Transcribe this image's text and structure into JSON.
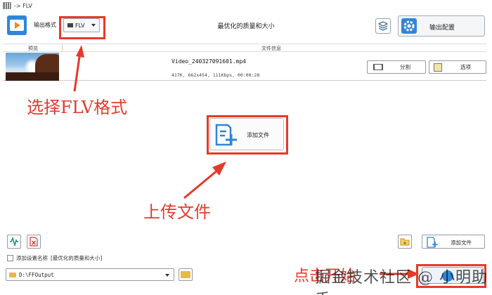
{
  "window": {
    "title": "-> FLV"
  },
  "toolbar": {
    "output_format_label": "输出格式",
    "format_value": "FLV",
    "preset_text": "最优化的质量和大小",
    "output_config_label": "输出配置"
  },
  "file_list": {
    "col_preview": "预览",
    "col_info": "文件信息",
    "items": [
      {
        "filename": "Video_240327091601.mp4",
        "meta": "417K, 662x454, 111Kbps, 00:00:28",
        "split_label": "分割",
        "options_label": "选项"
      }
    ]
  },
  "center": {
    "add_file_label": "添加文件"
  },
  "bottom": {
    "add_file_label": "添加文件",
    "save_settings_label": "添加设置名称",
    "save_settings_value": "[最优化的质量和大小]",
    "output_path": "D:\\FFOutput"
  },
  "annotations": {
    "select_format": "选择FLV格式",
    "upload_file": "上传文件",
    "click_start": "点击开始"
  },
  "watermark": "掘金技术社区 @ 小明助手",
  "colors": {
    "annotation_red": "#e53a2a",
    "accent_blue": "#2f86d9"
  }
}
